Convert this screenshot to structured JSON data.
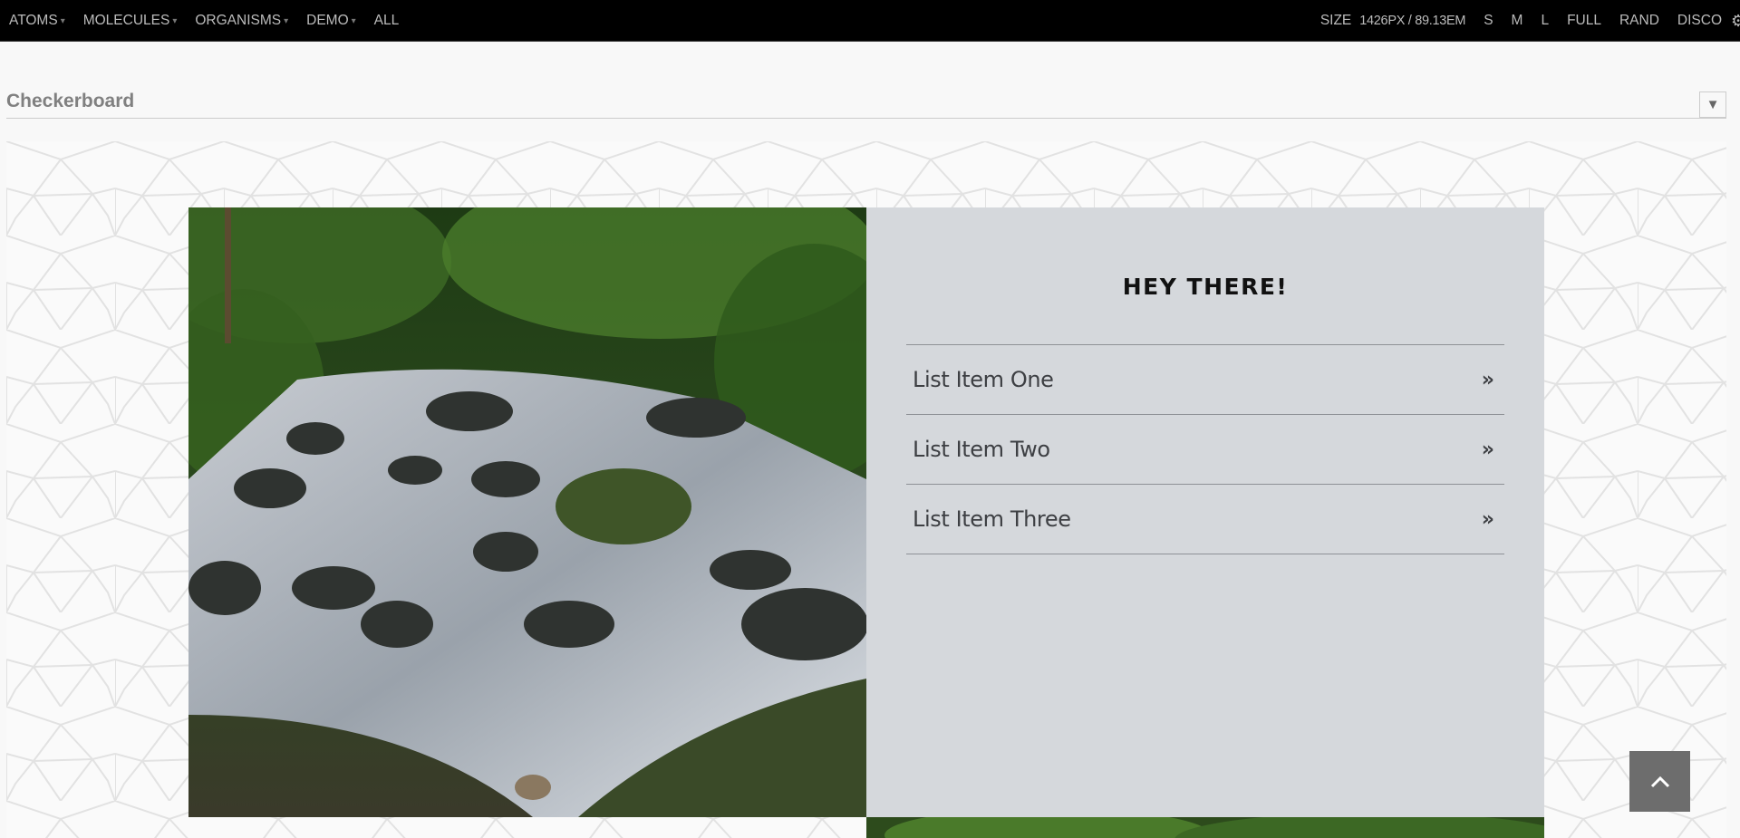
{
  "toolbar": {
    "nav": [
      {
        "label": "ATOMS",
        "has_caret": true
      },
      {
        "label": "MOLECULES",
        "has_caret": true
      },
      {
        "label": "ORGANISMS",
        "has_caret": true
      },
      {
        "label": "DEMO",
        "has_caret": true
      },
      {
        "label": "ALL",
        "has_caret": false
      }
    ],
    "caret_glyph": "▾",
    "size_label": "SIZE",
    "size_value": "1426PX / 89.13EM",
    "buttons": [
      "S",
      "M",
      "L",
      "FULL",
      "RAND",
      "DISCO"
    ],
    "gear_icon": "gear-icon"
  },
  "pattern": {
    "title": "Checkerboard",
    "toggle_glyph": "▼"
  },
  "panel": {
    "heading": "HEY THERE!",
    "items": [
      {
        "label": "List Item One",
        "icon": "double-chevron-right-icon"
      },
      {
        "label": "List Item Two",
        "icon": "double-chevron-right-icon"
      },
      {
        "label": "List Item Three",
        "icon": "double-chevron-right-icon"
      }
    ],
    "item_glyph": "»"
  },
  "colors": {
    "toolbar_bg": "#000000",
    "panel_bg": "#d5d8dc",
    "back_to_top_bg": "#6d6d6d"
  },
  "back_to_top_icon": "chevron-up-icon"
}
